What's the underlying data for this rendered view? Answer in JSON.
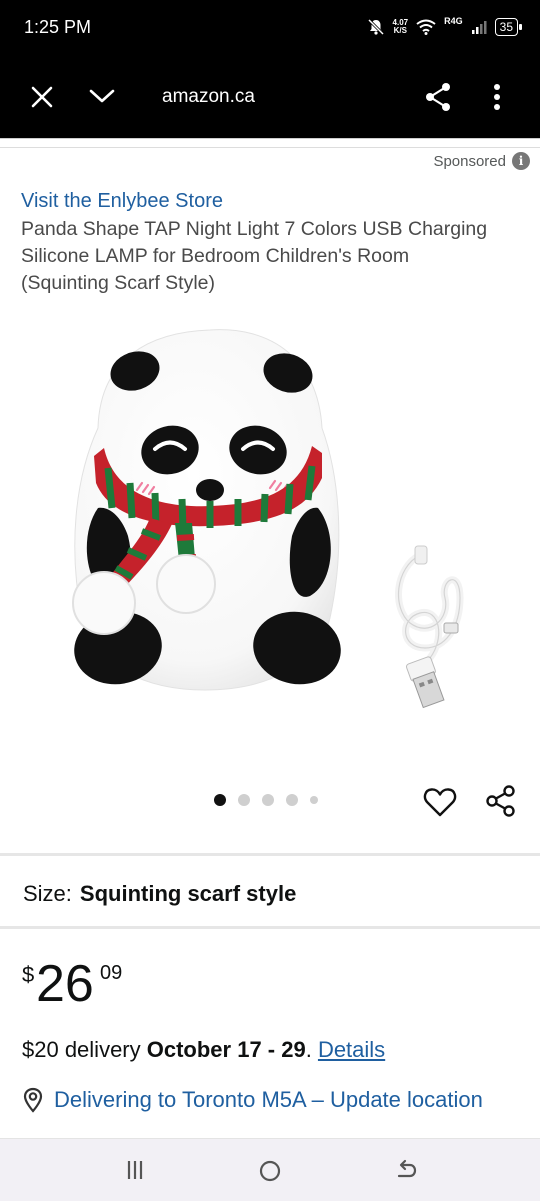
{
  "status_bar": {
    "time": "1:25 PM",
    "net_speed_value": "4.07",
    "net_speed_unit": "K/S",
    "signal_label": "R4G",
    "battery": "35"
  },
  "browser": {
    "url": "amazon.ca"
  },
  "sponsored_label": "Sponsored",
  "store_link": "Visit the Enlybee Store",
  "product": {
    "title": "Panda Shape TAP Night Light 7 Colors USB Charging Silicone LAMP for Bedroom Children's Room (Squinting Scarf Style)",
    "image_count": 5,
    "active_image": 1
  },
  "size": {
    "label": "Size:",
    "value": "Squinting scarf style"
  },
  "price": {
    "symbol": "$",
    "whole": "26",
    "fraction": "09"
  },
  "delivery": {
    "prefix": "$20 delivery ",
    "date": "October 17 - 29",
    "separator": ". ",
    "details_link": "Details"
  },
  "location": {
    "text": "Delivering to Toronto M5A – Update location"
  },
  "icons": {
    "close": "close-icon",
    "collapse": "chevron-down-icon",
    "share": "share-icon",
    "menu": "more-vertical-icon",
    "info": "info-icon",
    "heart": "heart-icon",
    "pin": "location-pin-icon"
  },
  "colors": {
    "link": "#1f5fa0",
    "text": "#0f1111",
    "bar": "#000000"
  }
}
